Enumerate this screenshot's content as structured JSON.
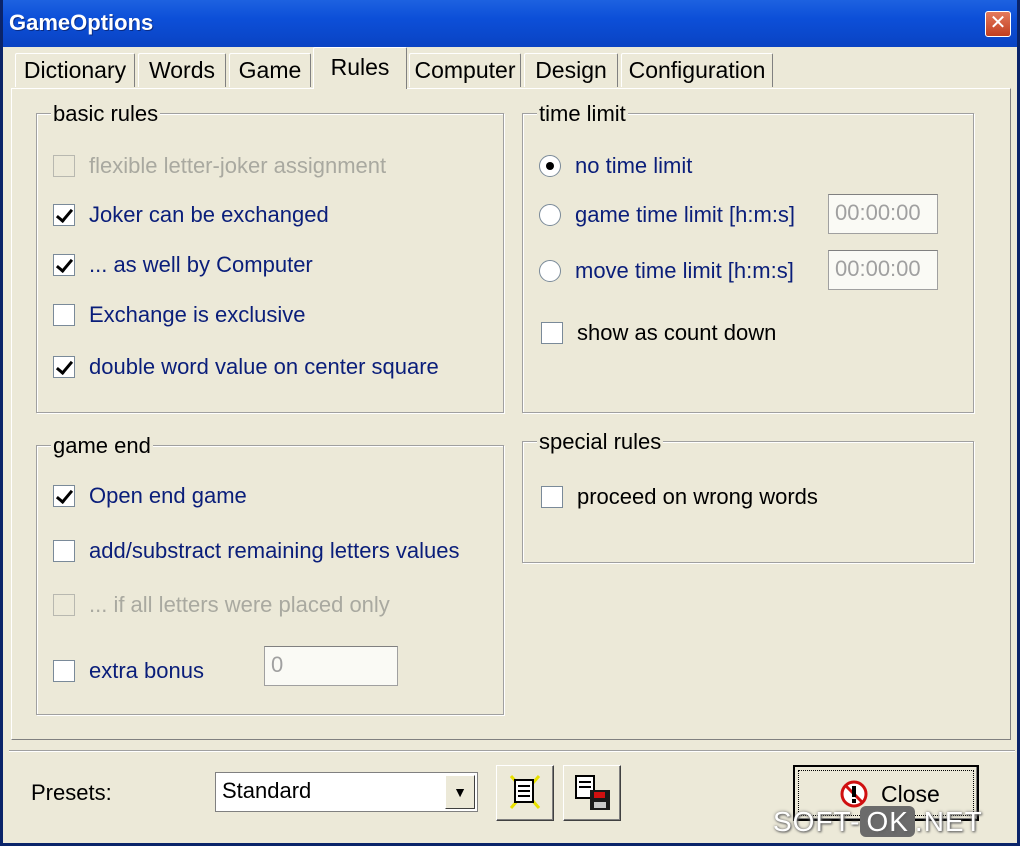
{
  "window": {
    "title": "GameOptions",
    "close_glyph": "✕"
  },
  "tabs": [
    {
      "label": "Dictionary"
    },
    {
      "label": "Words"
    },
    {
      "label": "Game"
    },
    {
      "label": "Rules",
      "active": true
    },
    {
      "label": "Computer"
    },
    {
      "label": "Design"
    },
    {
      "label": "Configuration"
    }
  ],
  "basic_rules": {
    "title": "basic rules",
    "items": [
      {
        "label": "flexible letter-joker assignment",
        "checked": false,
        "enabled": false
      },
      {
        "label": "Joker can be exchanged",
        "checked": true,
        "enabled": true
      },
      {
        "label": "... as well by Computer",
        "checked": true,
        "enabled": true
      },
      {
        "label": "Exchange is exclusive",
        "checked": false,
        "enabled": true
      },
      {
        "label": "double word value on center square",
        "checked": true,
        "enabled": true
      }
    ]
  },
  "time_limit": {
    "title": "time limit",
    "options": [
      {
        "label": "no time limit",
        "selected": true
      },
      {
        "label": "game time limit [h:m:s]",
        "selected": false,
        "value": "00:00:00"
      },
      {
        "label": "move time limit [h:m:s]",
        "selected": false,
        "value": "00:00:00"
      }
    ],
    "count_down": {
      "label": "show as count down",
      "checked": false
    }
  },
  "game_end": {
    "title": "game end",
    "items": [
      {
        "label": "Open end game",
        "checked": true,
        "enabled": true
      },
      {
        "label": "add/substract remaining letters values",
        "checked": false,
        "enabled": true
      },
      {
        "label": "... if all letters were placed only",
        "checked": false,
        "enabled": false
      },
      {
        "label": "extra bonus",
        "checked": false,
        "enabled": true
      }
    ],
    "extra_bonus_value": "0"
  },
  "special_rules": {
    "title": "special rules",
    "items": [
      {
        "label": "proceed on wrong words",
        "checked": false
      }
    ]
  },
  "bottom": {
    "presets_label": "Presets:",
    "presets_value": "Standard",
    "close_label": "Close"
  },
  "watermark": {
    "left": "SOFT-",
    "ok": "OK",
    "right": ".NET"
  }
}
